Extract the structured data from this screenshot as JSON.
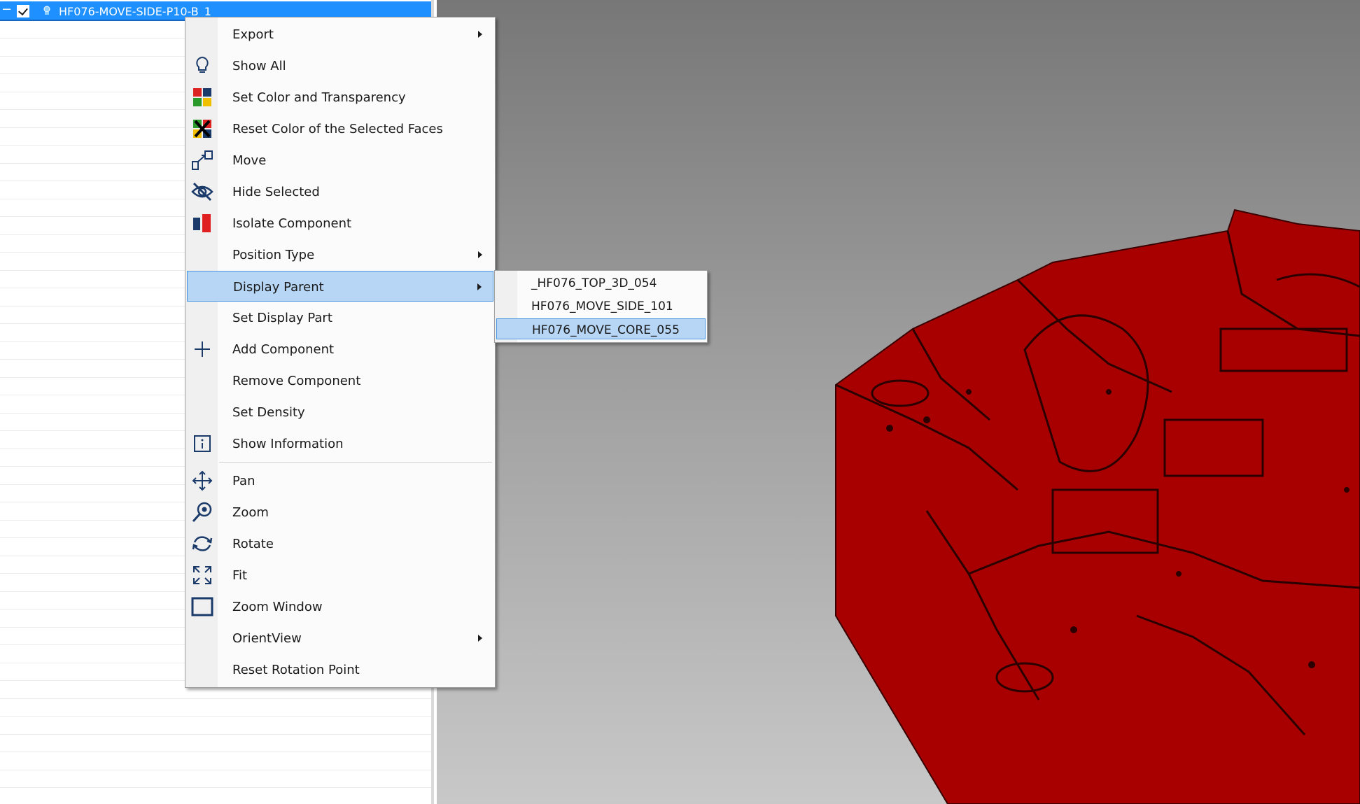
{
  "tree": {
    "selected_node": "HF076-MOVE-SIDE-P10-B_1",
    "checked": true
  },
  "context_menu": {
    "items": [
      {
        "label": "Export",
        "icon": "export",
        "submenu": true
      },
      {
        "label": "Show All",
        "icon": "lightbulb-icon"
      },
      {
        "label": "Set Color and Transparency",
        "icon": "color-grid-icon"
      },
      {
        "label": "Reset Color of the Selected Faces",
        "icon": "reset-color-icon"
      },
      {
        "label": "Move",
        "icon": "move-icon"
      },
      {
        "label": "Hide Selected",
        "icon": "eye-hidden-icon"
      },
      {
        "label": "Isolate Component",
        "icon": "isolate-icon"
      },
      {
        "label": "Position Type",
        "icon": "",
        "submenu": true
      },
      {
        "label": "Display Parent",
        "icon": "",
        "submenu": true,
        "highlighted": true
      },
      {
        "label": "Set Display Part",
        "icon": ""
      },
      {
        "label": "Add Component",
        "icon": "plus-icon"
      },
      {
        "label": "Remove Component",
        "icon": ""
      },
      {
        "label": "Set Density",
        "icon": ""
      },
      {
        "label": "Show Information",
        "icon": "info-icon"
      },
      {
        "label": "Pan",
        "icon": "pan-icon"
      },
      {
        "label": "Zoom",
        "icon": "zoom-icon"
      },
      {
        "label": "Rotate",
        "icon": "rotate-icon"
      },
      {
        "label": "Fit",
        "icon": "fit-icon"
      },
      {
        "label": "Zoom Window",
        "icon": "zoom-window-icon"
      },
      {
        "label": "OrientView",
        "icon": "",
        "submenu": true
      },
      {
        "label": "Reset Rotation Point",
        "icon": ""
      }
    ]
  },
  "submenu": {
    "items": [
      {
        "label": "_HF076_TOP_3D_054"
      },
      {
        "label": "HF076_MOVE_SIDE_101"
      },
      {
        "label": "HF076_MOVE_CORE_055",
        "highlighted": true
      }
    ]
  },
  "colors": {
    "selection": "#1e90ff",
    "menu_highlight": "#b7d6f5",
    "model_red": "#a80000"
  }
}
